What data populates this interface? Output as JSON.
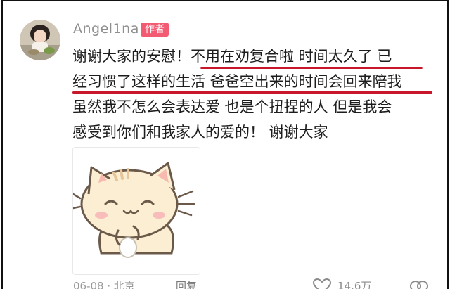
{
  "comment": {
    "username": "Angel1na",
    "badge": "作者",
    "lines": [
      "谢谢大家的安慰！不用在劝复合啦 时间太久了 已",
      "经习惯了这样的生活 爸爸空出来的时间会回来陪我",
      "虽然我不怎么会表达爱 也是个扭捏的人 但是我会",
      "感受到你们和我家人的爱的！ 谢谢大家"
    ],
    "underline_color": "#c8172a"
  },
  "footer": {
    "date_location": "06-08 · 北京",
    "reply_label": "回复",
    "likes": "14.6万"
  },
  "icons": {
    "avatar": "avatar-photo",
    "sticker": "cat-sticker",
    "like": "heart-icon",
    "more": "more-icon"
  },
  "colors": {
    "badge": "#f25b72",
    "username": "#8f8f8f"
  }
}
